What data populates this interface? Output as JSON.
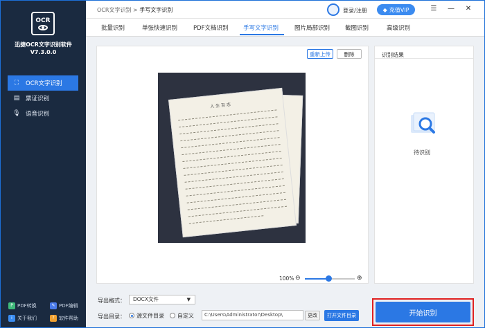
{
  "app": {
    "logo_text": "OCR",
    "name": "迅捷OCR文字识别软件",
    "version": "V7.3.0.0"
  },
  "sidebar": {
    "items": [
      {
        "label": "OCR文字识别",
        "icon": "scan-icon",
        "active": true
      },
      {
        "label": "票证识别",
        "icon": "ticket-icon",
        "active": false
      },
      {
        "label": "语音识别",
        "icon": "microphone-icon",
        "active": false
      }
    ],
    "bottom_links": [
      {
        "label": "PDF转换",
        "color": "#3fb97a",
        "icon": "pdf-convert-icon"
      },
      {
        "label": "PDF编辑",
        "color": "#4a7bea",
        "icon": "pdf-edit-icon"
      },
      {
        "label": "关于我们",
        "color": "#3a8cf0",
        "icon": "about-icon"
      },
      {
        "label": "软件帮助",
        "color": "#f0a030",
        "icon": "help-icon"
      }
    ]
  },
  "header": {
    "breadcrumb_root": "OCR文字识别",
    "breadcrumb_sep": ">",
    "breadcrumb_current": "手写文字识别",
    "login_label": "登录/注册",
    "vip_label": "充值VIP"
  },
  "tabs": [
    {
      "label": "批量识别",
      "active": false
    },
    {
      "label": "单张快速识别",
      "active": false
    },
    {
      "label": "PDF文档识别",
      "active": false
    },
    {
      "label": "手写文字识别",
      "active": true
    },
    {
      "label": "图片局部识别",
      "active": false
    },
    {
      "label": "截图识别",
      "active": false
    },
    {
      "label": "高级识别",
      "active": false
    }
  ],
  "preview": {
    "reupload_label": "重新上传",
    "delete_label": "删除",
    "zoom_level": "100%",
    "zoom_fraction": 0.48,
    "paper_title": "人 生 百 态"
  },
  "result": {
    "title": "识别结果",
    "status": "待识别"
  },
  "export": {
    "format_label": "导出格式：",
    "format_value": "DOCX文件",
    "dir_label": "导出目录：",
    "option_source": "源文件目录",
    "option_custom": "自定义",
    "path": "C:\\Users\\Administrator\\Desktop\\",
    "change_label": "更改",
    "open_dir_label": "打开文件目录"
  },
  "start_label": "开始识别",
  "colors": {
    "accent": "#2b78e4",
    "sidebar_bg": "#1a2a40",
    "highlight_border": "#e02020"
  }
}
